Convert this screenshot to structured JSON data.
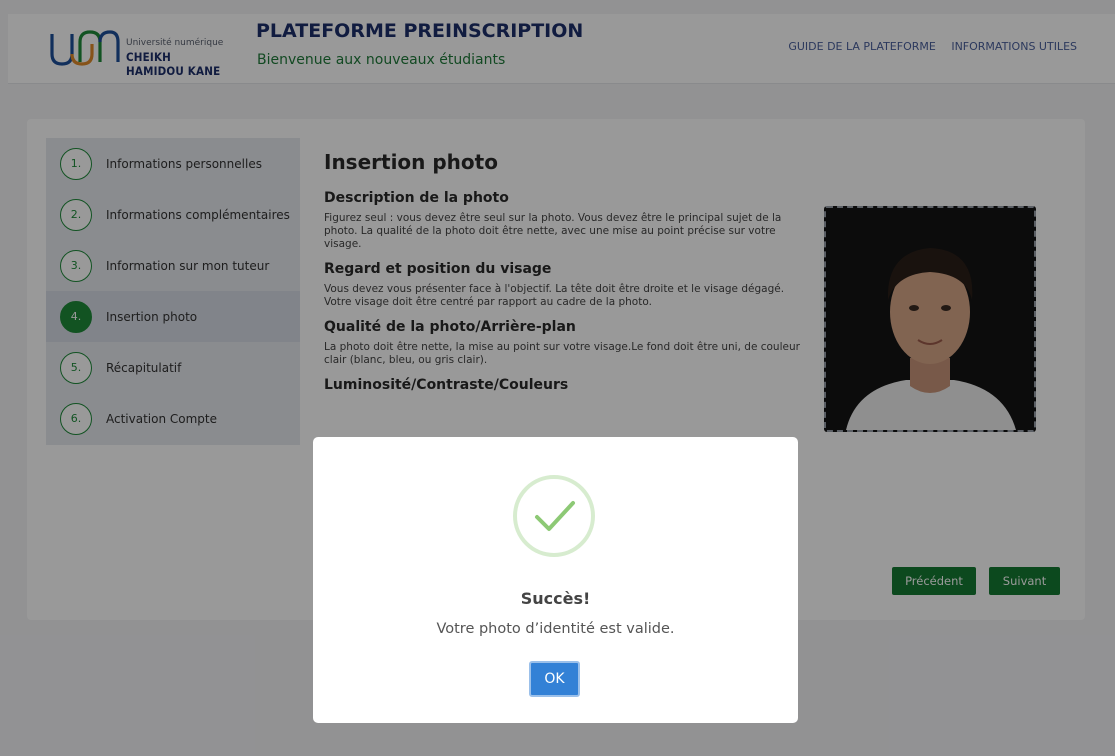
{
  "header": {
    "logo_sub": "Université numérique",
    "logo_name": "CHEIKH HAMIDOU KANE",
    "title": "PLATEFORME PREINSCRIPTION",
    "subtitle": "Bienvenue aux nouveaux étudiants",
    "links": [
      "GUIDE DE LA PLATEFORME",
      "INFORMATIONS UTILES"
    ]
  },
  "steps": [
    {
      "num": "1.",
      "label": "Informations personnelles",
      "active": false
    },
    {
      "num": "2.",
      "label": "Informations complémentaires",
      "active": false
    },
    {
      "num": "3.",
      "label": "Information sur mon tuteur",
      "active": false
    },
    {
      "num": "4.",
      "label": "Insertion photo",
      "active": true
    },
    {
      "num": "5.",
      "label": "Récapitulatif",
      "active": false
    },
    {
      "num": "6.",
      "label": "Activation Compte",
      "active": false
    }
  ],
  "content": {
    "title": "Insertion photo",
    "sections": [
      {
        "heading": "Description de la photo",
        "text": "Figurez seul : vous devez être seul sur la photo. Vous devez être le principal sujet de la photo. La qualité de la photo doit être nette, avec une mise au point précise sur votre visage."
      },
      {
        "heading": "Regard et position du visage",
        "text": "Vous devez vous présenter face à l'objectif. La tête doit être droite et le visage dégagé. Votre visage doit être centré par rapport au cadre de la photo."
      },
      {
        "heading": "Qualité de la photo/Arrière-plan",
        "text": "La photo doit être nette, la mise au point sur votre visage.Le fond doit être uni, de couleur clair (blanc, bleu, ou gris clair)."
      },
      {
        "heading": "Luminosité/Contraste/Couleurs",
        "text": ""
      }
    ]
  },
  "buttons": {
    "prev": "Précédent",
    "next": "Suivant"
  },
  "modal": {
    "title": "Succès!",
    "message": "Votre photo d’identité est valide.",
    "ok": "OK"
  },
  "colors": {
    "brand_blue": "#1d2f6b",
    "brand_green": "#1f8a3a",
    "button_green": "#157a32",
    "ok_blue": "#3381d6",
    "success_check": "#8dc975"
  }
}
